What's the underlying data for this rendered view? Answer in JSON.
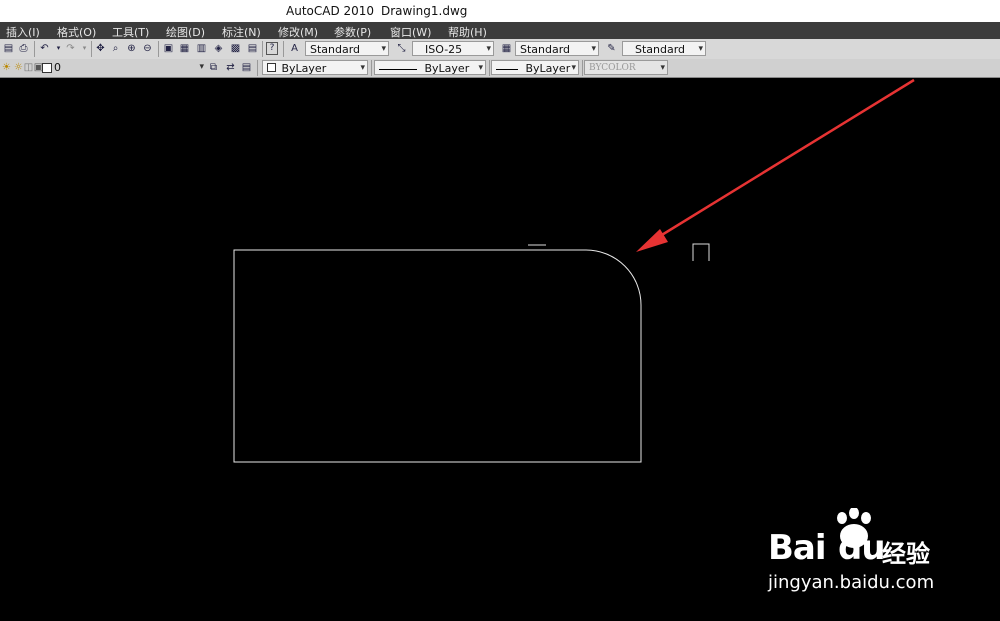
{
  "title": {
    "app": "AutoCAD 2010",
    "file": "Drawing1.dwg"
  },
  "menu": [
    "插入(I)",
    "格式(O)",
    "工具(T)",
    "绘图(D)",
    "标注(N)",
    "修改(M)",
    "参数(P)",
    "窗口(W)",
    "帮助(H)"
  ],
  "styles_toolbar": {
    "text_style": "Standard",
    "dim_style": "ISO-25",
    "table_style": "Standard",
    "multileader_style": "Standard"
  },
  "layers_toolbar": {
    "layer": "0",
    "color": "ByLayer",
    "linetype": "ByLayer",
    "lineweight": "ByLayer",
    "plotstyle": "BYCOLOR"
  },
  "watermark": {
    "brand_1": "Bai",
    "brand_2": "du",
    "brand_cn": "经验",
    "url": "jingyan.baidu.com"
  }
}
